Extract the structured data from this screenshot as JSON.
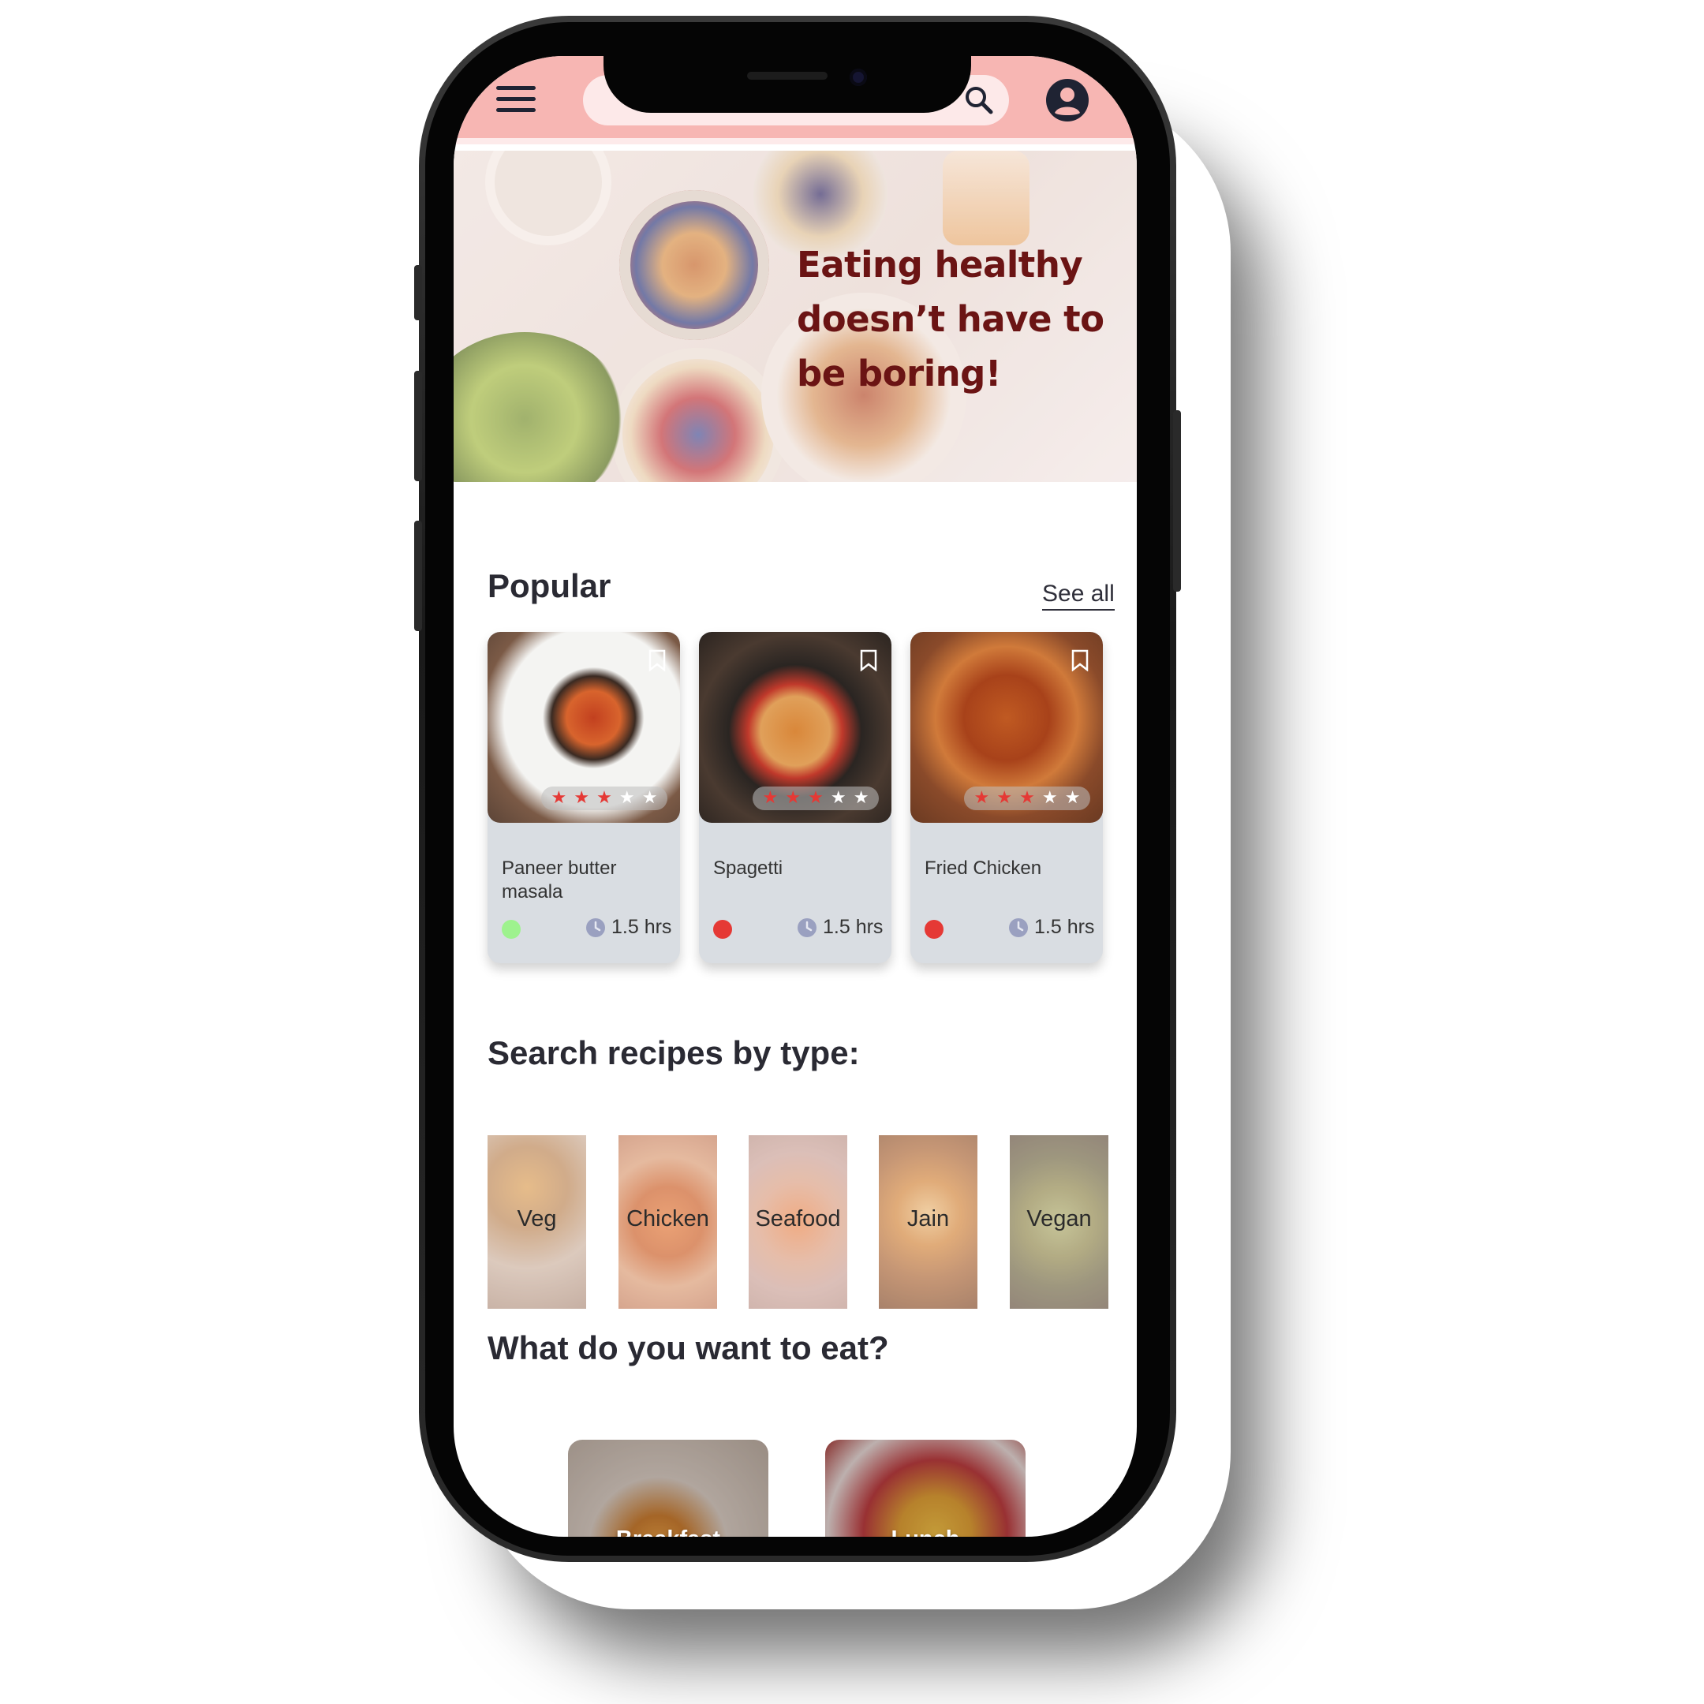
{
  "header": {
    "search_placeholder": ""
  },
  "hero": {
    "line1": "Eating healthy",
    "line2": "doesn’t have to",
    "line3": "be boring!"
  },
  "popular": {
    "title": "Popular",
    "see_all": "See all",
    "cards": [
      {
        "name": "Paneer butter masala",
        "time": "1.5 hrs",
        "rating": 3,
        "max_rating": 5,
        "diet": "veg",
        "diet_color": "#9ef28e"
      },
      {
        "name": "Spagetti",
        "time": "1.5 hrs",
        "rating": 3,
        "max_rating": 5,
        "diet": "non-veg",
        "diet_color": "#e53935"
      },
      {
        "name": "Fried Chicken",
        "time": "1.5 hrs",
        "rating": 3,
        "max_rating": 5,
        "diet": "non-veg",
        "diet_color": "#e53935"
      }
    ]
  },
  "types": {
    "title": "Search recipes by type:",
    "items": [
      "Veg",
      "Chicken",
      "Seafood",
      "Jain",
      "Vegan"
    ]
  },
  "meals": {
    "title": "What do you want to eat?",
    "items": [
      "Breakfast",
      "Lunch"
    ]
  },
  "colors": {
    "topbar": "#f7b6b3",
    "hero_text": "#6b1414",
    "card_bg": "#d9dde2",
    "star": "#e53935"
  }
}
